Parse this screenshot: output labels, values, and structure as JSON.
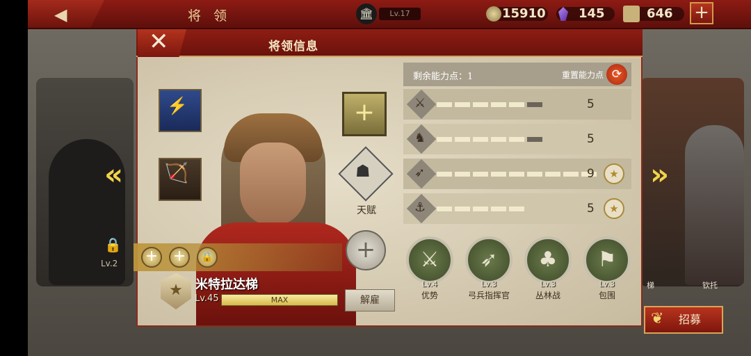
{
  "topbar": {
    "title": "将 领",
    "building_level": "Lv.17",
    "coins": "15910",
    "gems": "145",
    "food": "646",
    "plus": "+"
  },
  "background": {
    "left_level": "Lv.2",
    "right_names": [
      "梯",
      "钦托"
    ],
    "recruit_label": "招募"
  },
  "panel": {
    "title": "将领信息",
    "close": "✕",
    "talent_label": "天赋",
    "hero": {
      "name": "米特拉达梯",
      "level": "Lv.45",
      "exp_text": "MAX"
    },
    "dismiss_label": "解雇",
    "stats": {
      "remaining_label": "剩余能力点：1",
      "reset_label": "重置能力点",
      "rows": [
        {
          "icon": "sword-icon",
          "glyph": "⚔",
          "value": "5",
          "filled": 5,
          "total": 6,
          "badge": false
        },
        {
          "icon": "horse-icon",
          "glyph": "♞",
          "value": "5",
          "filled": 5,
          "total": 6,
          "badge": false
        },
        {
          "icon": "bow-icon",
          "glyph": "➶",
          "value": "9",
          "filled": 9,
          "total": 9,
          "badge": true
        },
        {
          "icon": "anchor-icon",
          "glyph": "⚓",
          "value": "5",
          "filled": 5,
          "total": 5,
          "badge": true
        }
      ]
    },
    "skills": [
      {
        "level": "Lv.4",
        "name": "优势",
        "glyph": "⚔"
      },
      {
        "level": "Lv.3",
        "name": "弓兵指挥官",
        "glyph": "➶"
      },
      {
        "level": "Lv.3",
        "name": "丛林战",
        "glyph": "♣"
      },
      {
        "level": "Lv.3",
        "name": "包围",
        "glyph": "⚑"
      }
    ]
  },
  "colors": {
    "accent": "#8e1d14",
    "gold": "#d9a55a",
    "panel_bg": "#d2c7ae"
  }
}
